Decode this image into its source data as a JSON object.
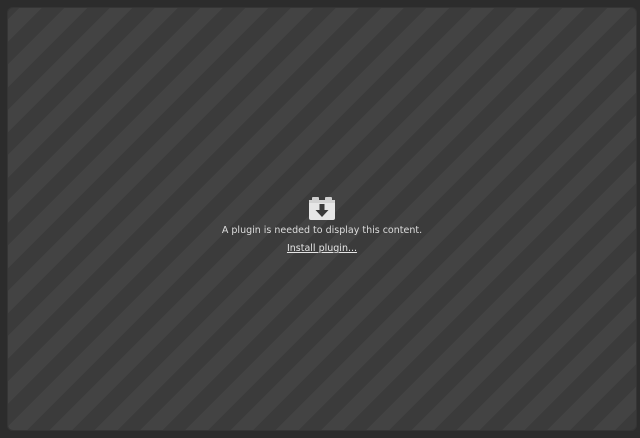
{
  "plugin": {
    "icon": "plugin-download-icon",
    "message": "A plugin is needed to display this content.",
    "install_link": "Install plugin..."
  },
  "colors": {
    "background": "#2c2c2c",
    "stripe_dark": "#3b3b3b",
    "stripe_light": "#434343",
    "text": "#dcdcdc"
  }
}
